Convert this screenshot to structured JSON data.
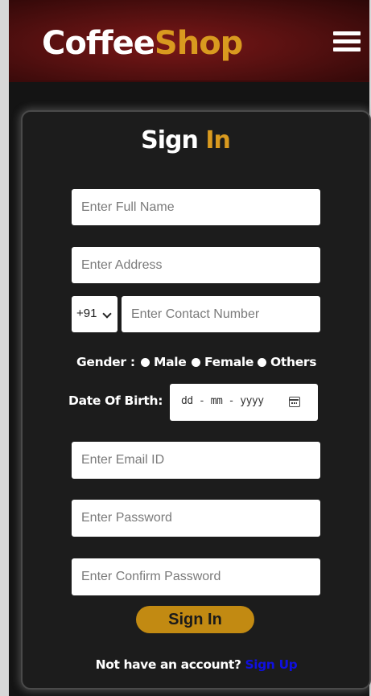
{
  "header": {
    "brand_part1": "Coffee",
    "brand_part2": "Shop",
    "menu_icon": "hamburger-menu-icon"
  },
  "form": {
    "title_part1": "Sign",
    "title_part2": "In",
    "full_name_placeholder": "Enter Full Name",
    "address_placeholder": "Enter Address",
    "country_code": "+91",
    "contact_placeholder": "Enter Contact Number",
    "gender_label": "Gender :",
    "gender_options": [
      "Male",
      "Female",
      "Others"
    ],
    "dob_label": "Date Of Birth:",
    "dob_placeholder": "dd - mm - yyyy",
    "calendar_icon": "calendar-icon",
    "email_placeholder": "Enter Email ID",
    "password_placeholder": "Enter Password",
    "confirm_password_placeholder": "Enter Confirm Password",
    "submit_label": "Sign In",
    "footer_text": "Not have an account?",
    "footer_link": "Sign Up"
  },
  "colors": {
    "header_bg": "#5a1010",
    "accent": "#d99a1f",
    "button_bg": "#c28a12",
    "card_bg": "#1c1c1c",
    "page_bg": "#141414",
    "link": "#1010e0"
  }
}
